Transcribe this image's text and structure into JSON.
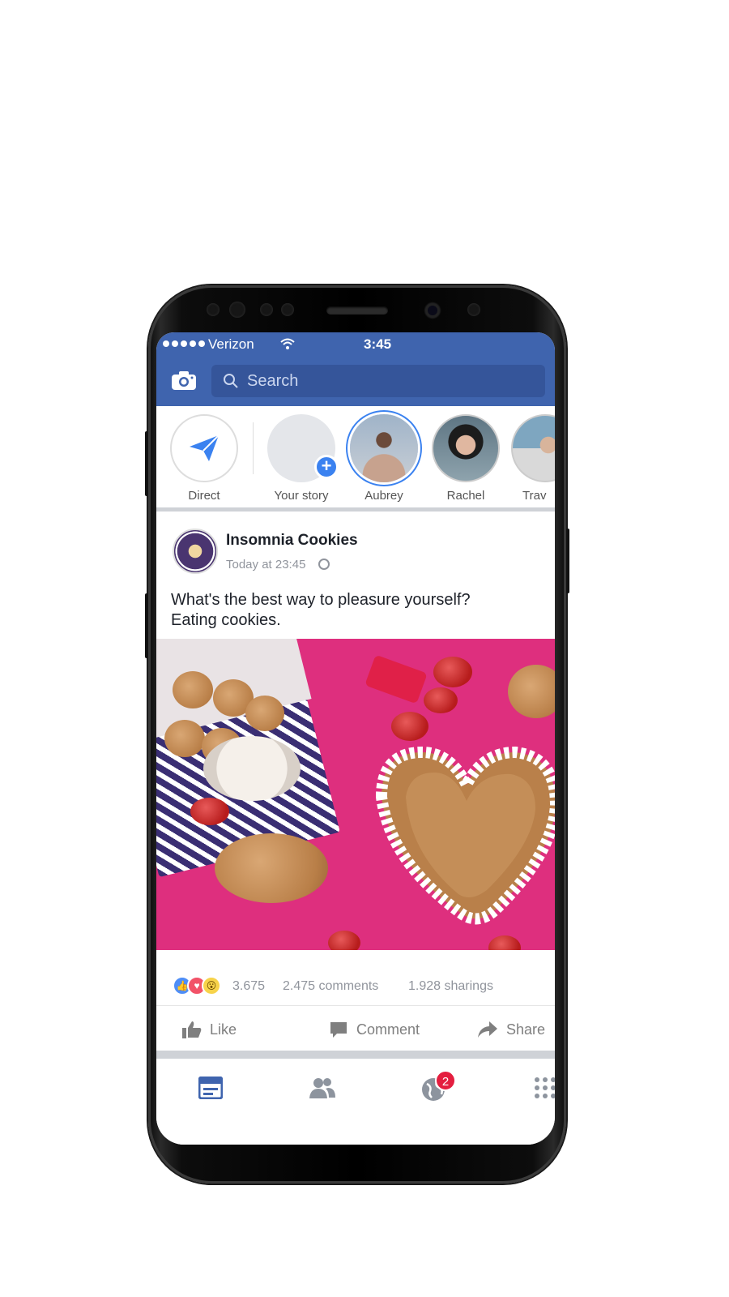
{
  "status_bar": {
    "carrier": "Verizon",
    "time": "3:45"
  },
  "header": {
    "search_placeholder": "Search"
  },
  "stories": [
    {
      "label": "Direct"
    },
    {
      "label": "Your story"
    },
    {
      "label": "Aubrey"
    },
    {
      "label": "Rachel"
    },
    {
      "label": "Trav"
    }
  ],
  "post": {
    "author": "Insomnia Cookies",
    "timestamp": "Today at 23:45",
    "text_line1": "What's the best way to pleasure yourself?",
    "text_line2": "Eating cookies.",
    "reaction_count": "3.675",
    "comments": "2.475 comments",
    "sharings": "1.928 sharings"
  },
  "actions": {
    "like": "Like",
    "comment": "Comment",
    "share": "Share"
  },
  "tabbar": {
    "notification_badge": "2"
  },
  "colors": {
    "brand": "#3f64ae",
    "accent": "#3b82f0",
    "badge": "#e41e3f"
  }
}
